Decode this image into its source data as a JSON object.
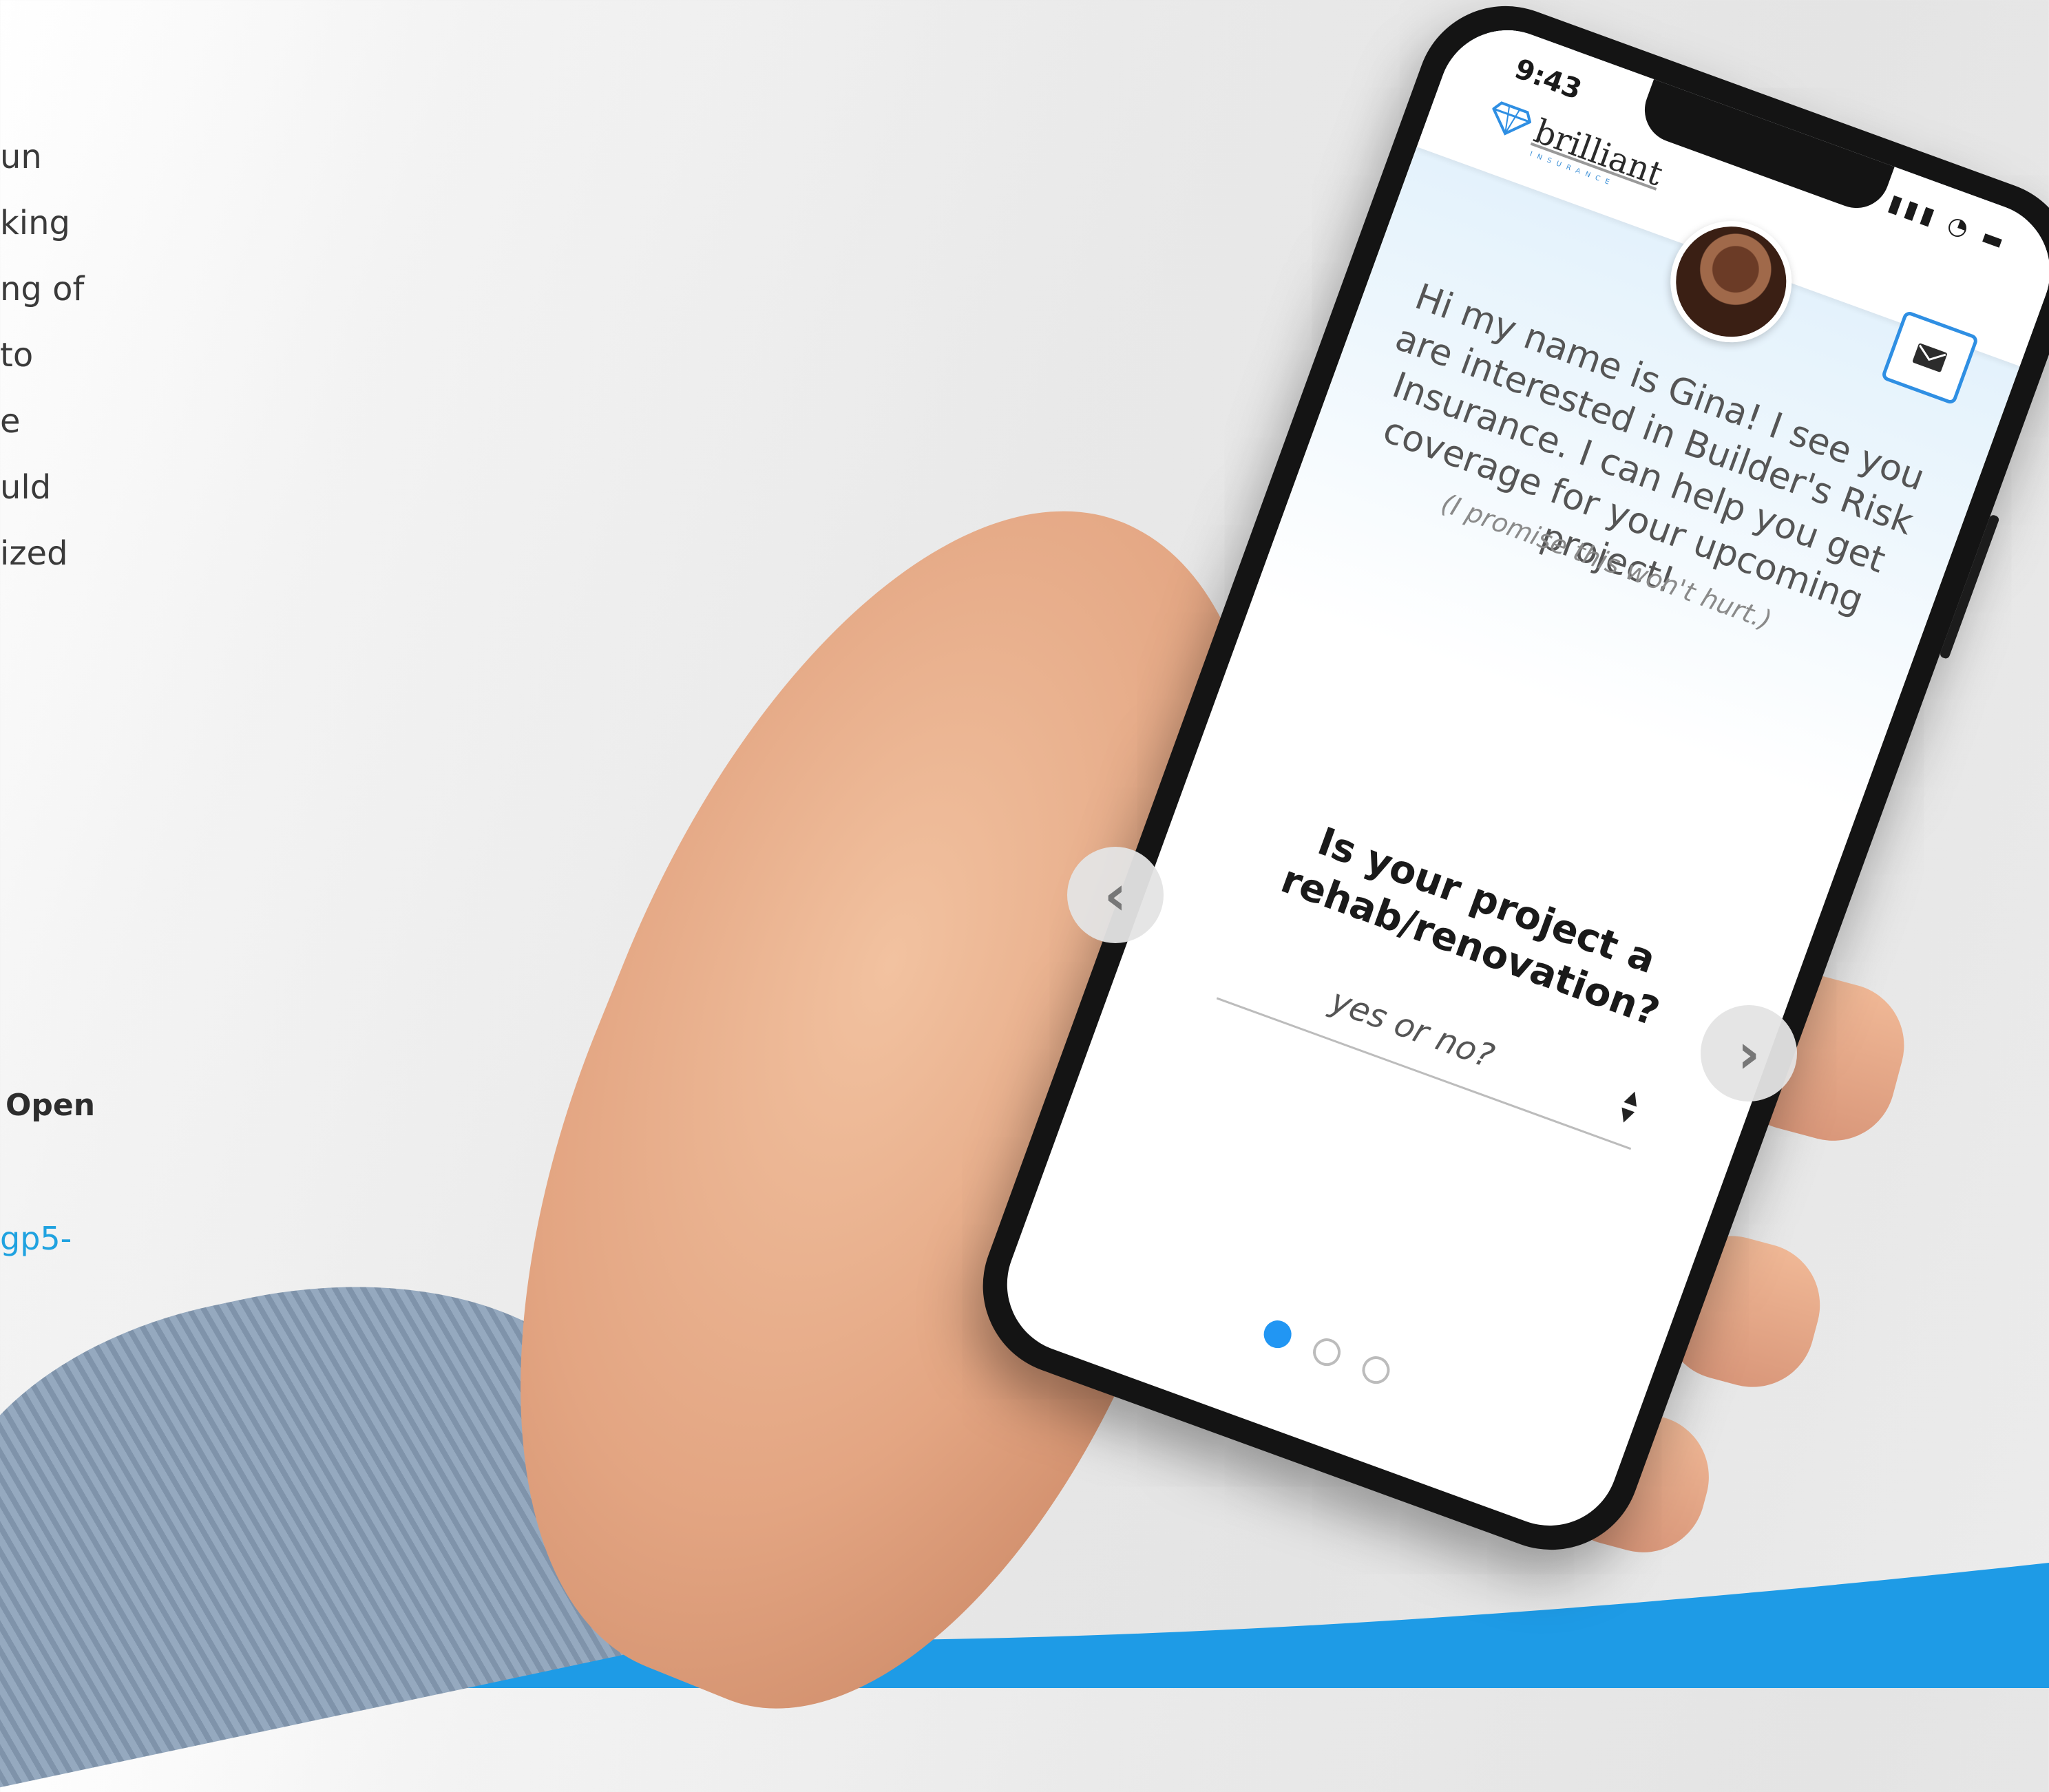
{
  "background_text": {
    "lines": [
      "un",
      "king",
      "ng of",
      "to",
      "e",
      "uld",
      "ized"
    ],
    "open_label": "Open",
    "link_fragment": "gp5-"
  },
  "phone": {
    "status_time": "9:43",
    "brand": {
      "name": "brilliant",
      "sub": "INSURANCE",
      "color": "#2f8fe3"
    },
    "intro_text": "Hi my name is Gina! I see you are interested in Builder's Risk Insurance. I can help you get coverage for your upcoming project!",
    "intro_note": "(I promise this won't hurt.)",
    "question": "Is your project a rehab/renovation?",
    "answer_placeholder": "yes or no?",
    "pagination": {
      "total": 3,
      "current": 1
    },
    "accent": "#2196f3",
    "icons": [
      "diamond-logo-icon",
      "mail-icon",
      "signal-icon",
      "wifi-icon",
      "battery-icon",
      "chevron-left-icon",
      "chevron-right-icon"
    ]
  }
}
